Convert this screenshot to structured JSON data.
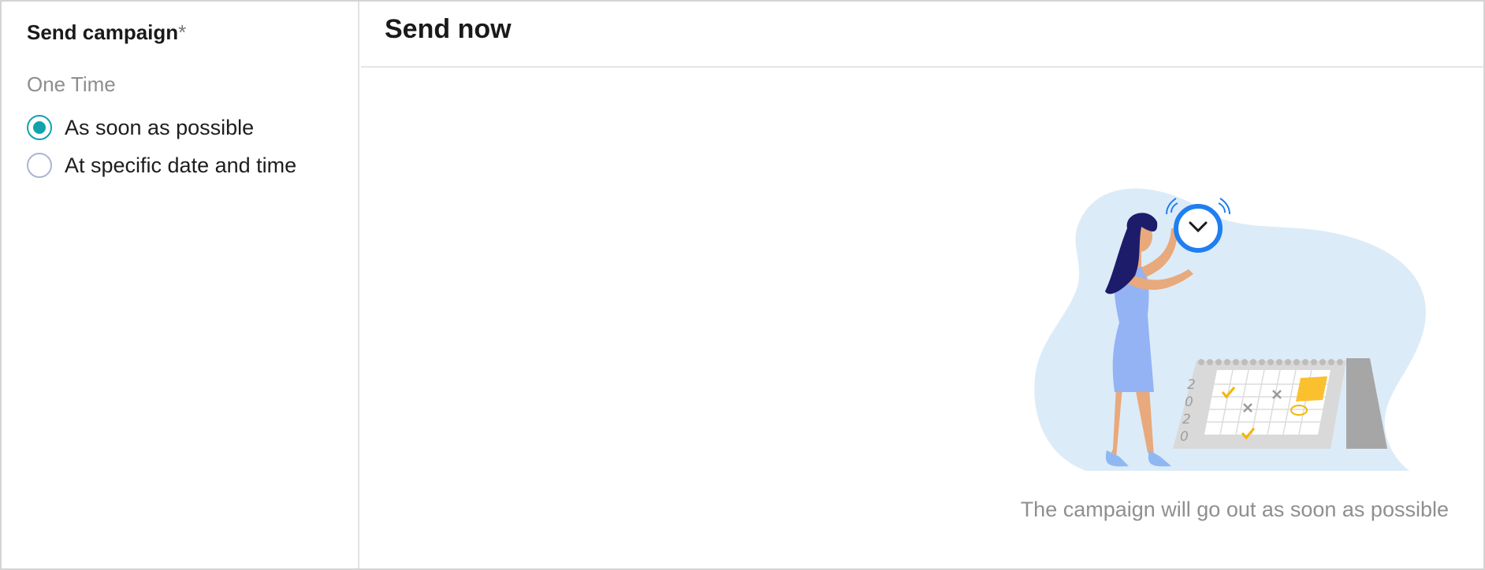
{
  "sidebar": {
    "title": "Send campaign",
    "required_marker": "*",
    "section_label": "One Time",
    "options": [
      {
        "label": "As soon as possible",
        "checked": true
      },
      {
        "label": "At specific date and time",
        "checked": false
      }
    ]
  },
  "main": {
    "title": "Send now",
    "illustration": {
      "calendar_year_digits": [
        "2",
        "0",
        "2",
        "0"
      ]
    },
    "caption": "The campaign will go out as soon as possible"
  },
  "colors": {
    "accent": "#11a2ac",
    "blob": "#dcebf8",
    "clock_ring": "#1f7ff0"
  }
}
